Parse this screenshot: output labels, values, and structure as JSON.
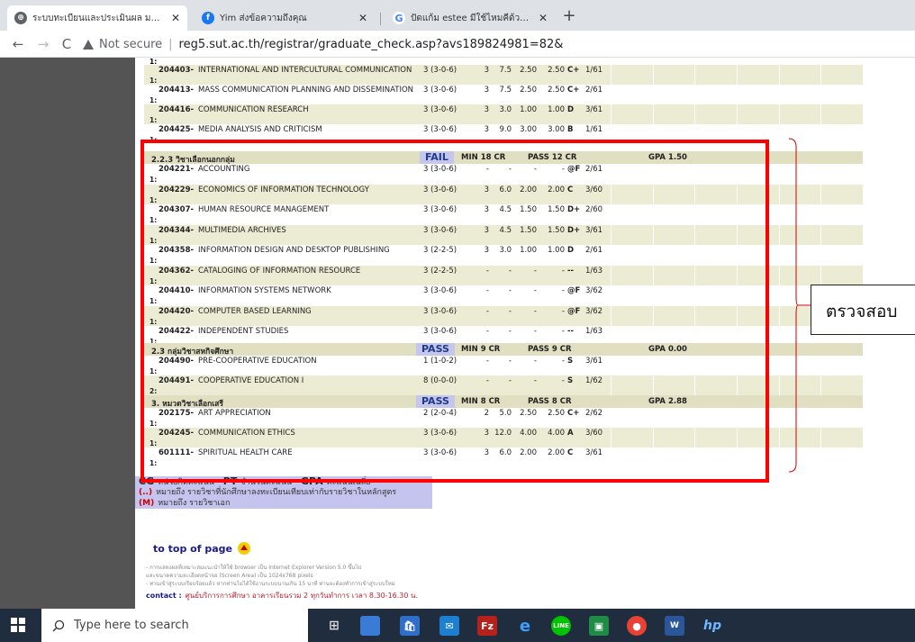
{
  "browser": {
    "tabs": [
      {
        "label": "ระบบทะเบียนและประเมินผล มหาวิทยาลั",
        "icon": "globe-icon",
        "active": true
      },
      {
        "label": "Yim ส่งข้อความถึงคุณ",
        "icon": "facebook-icon",
        "active": false
      },
      {
        "label": "ปัดแก้ม estee มีใช้ไหมคีด้วย - ค้นหาด้วย",
        "icon": "google-icon",
        "active": false
      }
    ],
    "not_secure": "Not secure",
    "url": "reg5.sut.ac.th/registrar/graduate_check.asp?avs189824981=82&"
  },
  "courses_top": [
    {
      "code": "204403-",
      "name": "INTERNATIONAL AND INTERCULTURAL COMMUNICATION",
      "credit": "3 (3-0-6)",
      "cr": "3",
      "pts": "7.5",
      "gp": "2.50",
      "gp2": "2.50",
      "grade": "C+",
      "term": "1/61"
    },
    {
      "code": "204413-",
      "name": "MASS COMMUNICATION PLANNING AND DISSEMINATION",
      "credit": "3 (3-0-6)",
      "cr": "3",
      "pts": "7.5",
      "gp": "2.50",
      "gp2": "2.50",
      "grade": "C+",
      "term": "2/61"
    },
    {
      "code": "204416-",
      "name": "COMMUNICATION RESEARCH",
      "credit": "3 (3-0-6)",
      "cr": "3",
      "pts": "3.0",
      "gp": "1.00",
      "gp2": "1.00",
      "grade": "D",
      "term": "3/61"
    },
    {
      "code": "204425-",
      "name": "MEDIA ANALYSIS AND CRITICISM",
      "credit": "3 (3-0-6)",
      "cr": "3",
      "pts": "9.0",
      "gp": "3.00",
      "gp2": "3.00",
      "grade": "B",
      "term": "1/61"
    }
  ],
  "group_a": {
    "title": "2.2.3 วิชาเลือกนอกกลุ่ม",
    "status": "FAIL",
    "min": "MIN 18 CR",
    "pass": "PASS 12 CR",
    "gpa": "GPA 1.50"
  },
  "courses_a": [
    {
      "code": "204221-",
      "name": "ACCOUNTING",
      "credit": "3 (3-0-6)",
      "cr": "-",
      "pts": "-",
      "gp": "-",
      "gp2": "-",
      "grade": "@F",
      "term": "2/61"
    },
    {
      "code": "204229-",
      "name": "ECONOMICS OF INFORMATION TECHNOLOGY",
      "credit": "3 (3-0-6)",
      "cr": "3",
      "pts": "6.0",
      "gp": "2.00",
      "gp2": "2.00",
      "grade": "C",
      "term": "3/60"
    },
    {
      "code": "204307-",
      "name": "HUMAN RESOURCE MANAGEMENT",
      "credit": "3 (3-0-6)",
      "cr": "3",
      "pts": "4.5",
      "gp": "1.50",
      "gp2": "1.50",
      "grade": "D+",
      "term": "2/60"
    },
    {
      "code": "204344-",
      "name": "MULTIMEDIA ARCHIVES",
      "credit": "3 (3-0-6)",
      "cr": "3",
      "pts": "4.5",
      "gp": "1.50",
      "gp2": "1.50",
      "grade": "D+",
      "term": "3/61"
    },
    {
      "code": "204358-",
      "name": "INFORMATION DESIGN AND DESKTOP PUBLISHING",
      "credit": "3 (2-2-5)",
      "cr": "3",
      "pts": "3.0",
      "gp": "1.00",
      "gp2": "1.00",
      "grade": "D",
      "term": "2/61"
    },
    {
      "code": "204362-",
      "name": "CATALOGING OF INFORMATION RESOURCE",
      "credit": "3 (2-2-5)",
      "cr": "-",
      "pts": "-",
      "gp": "-",
      "gp2": "-",
      "grade": "--",
      "term": "1/63"
    },
    {
      "code": "204410-",
      "name": "INFORMATION SYSTEMS NETWORK",
      "credit": "3 (3-0-6)",
      "cr": "-",
      "pts": "-",
      "gp": "-",
      "gp2": "-",
      "grade": "@F",
      "term": "3/62"
    },
    {
      "code": "204420-",
      "name": "COMPUTER BASED LEARNING",
      "credit": "3 (3-0-6)",
      "cr": "-",
      "pts": "-",
      "gp": "-",
      "gp2": "-",
      "grade": "@F",
      "term": "3/62"
    },
    {
      "code": "204422-",
      "name": "INDEPENDENT STUDIES",
      "credit": "3 (3-0-6)",
      "cr": "-",
      "pts": "-",
      "gp": "-",
      "gp2": "-",
      "grade": "--",
      "term": "1/63"
    }
  ],
  "group_b": {
    "title": "2.3 กลุ่มวิชาสหกิจศึกษา",
    "status": "PASS",
    "min": "MIN 9 CR",
    "pass": "PASS 9 CR",
    "gpa": "GPA 0.00"
  },
  "courses_b": [
    {
      "code": "204490-",
      "name": "PRE-COOPERATIVE EDUCATION",
      "credit": "1 (1-0-2)",
      "cr": "-",
      "pts": "-",
      "gp": "-",
      "gp2": "-",
      "grade": "S",
      "term": "3/61",
      "lead": "1:"
    },
    {
      "code": "204491-",
      "name": "COOPERATIVE EDUCATION I",
      "credit": "8 (0-0-0)",
      "cr": "-",
      "pts": "-",
      "gp": "-",
      "gp2": "-",
      "grade": "S",
      "term": "1/62",
      "lead": "2:"
    }
  ],
  "group_c": {
    "title": "3. หมวดวิชาเลือกเสรี",
    "status": "PASS",
    "min": "MIN 8 CR",
    "pass": "PASS 8 CR",
    "gpa": "GPA 2.88"
  },
  "courses_c": [
    {
      "code": "202175-",
      "name": "ART APPRECIATION",
      "credit": "2 (2-0-4)",
      "cr": "2",
      "pts": "5.0",
      "gp": "2.50",
      "gp2": "2.50",
      "grade": "C+",
      "term": "2/62"
    },
    {
      "code": "204245-",
      "name": "COMMUNICATION ETHICS",
      "credit": "3 (3-0-6)",
      "cr": "3",
      "pts": "12.0",
      "gp": "4.00",
      "gp2": "4.00",
      "grade": "A",
      "term": "3/60"
    },
    {
      "code": "601111-",
      "name": "SPIRITUAL HEALTH CARE",
      "credit": "3 (3-0-6)",
      "cr": "3",
      "pts": "6.0",
      "gp": "2.00",
      "gp2": "2.00",
      "grade": "C",
      "term": "3/61"
    }
  ],
  "row_lead": "1:",
  "legend": {
    "cg": "CG",
    "cg_text": "หน่วยกิตคะแนน",
    "pt": "PT",
    "pt_text": "จำนวนคะแนน",
    "gpa": "GPA",
    "gpa_text": "คะแนนเฉลี่ย",
    "paren": "(..)",
    "paren_text": "หมายถึง รายวิชาที่นักศึกษาลงทะเบียนเทียบเท่ากับรายวิชาในหลักสูตร",
    "m": "(M)",
    "m_text": "หมายถึง รายวิชาเอก"
  },
  "to_top": "to top of page",
  "notes": [
    "- การแสดงผลที่เหมาะสมแนะนำให้ใช้ browser เป็น Internet Explorer Version 5.0 ขึ้นไป",
    "  และขนาดความละเอียดหน้าจอ (Screen Area) เป็น 1024x768 pixels",
    "- ท่านเข้าสู่ระบบเรียบร้อยแล้ว หากท่านไม่ได้ใช้งานระบบนานเกิน 15 นาที ท่านจะต้องทำการเข้าสู่ระบบใหม่"
  ],
  "contact_label": "contact :",
  "contact_text": "ศูนย์บริการการศึกษา อาคารเรียนรวม 2 ทุกวันทำการ เวลา 8.30-16.30 น.",
  "annotation": "ตรวจสอบ",
  "taskbar": {
    "search_placeholder": "Type here to search"
  }
}
